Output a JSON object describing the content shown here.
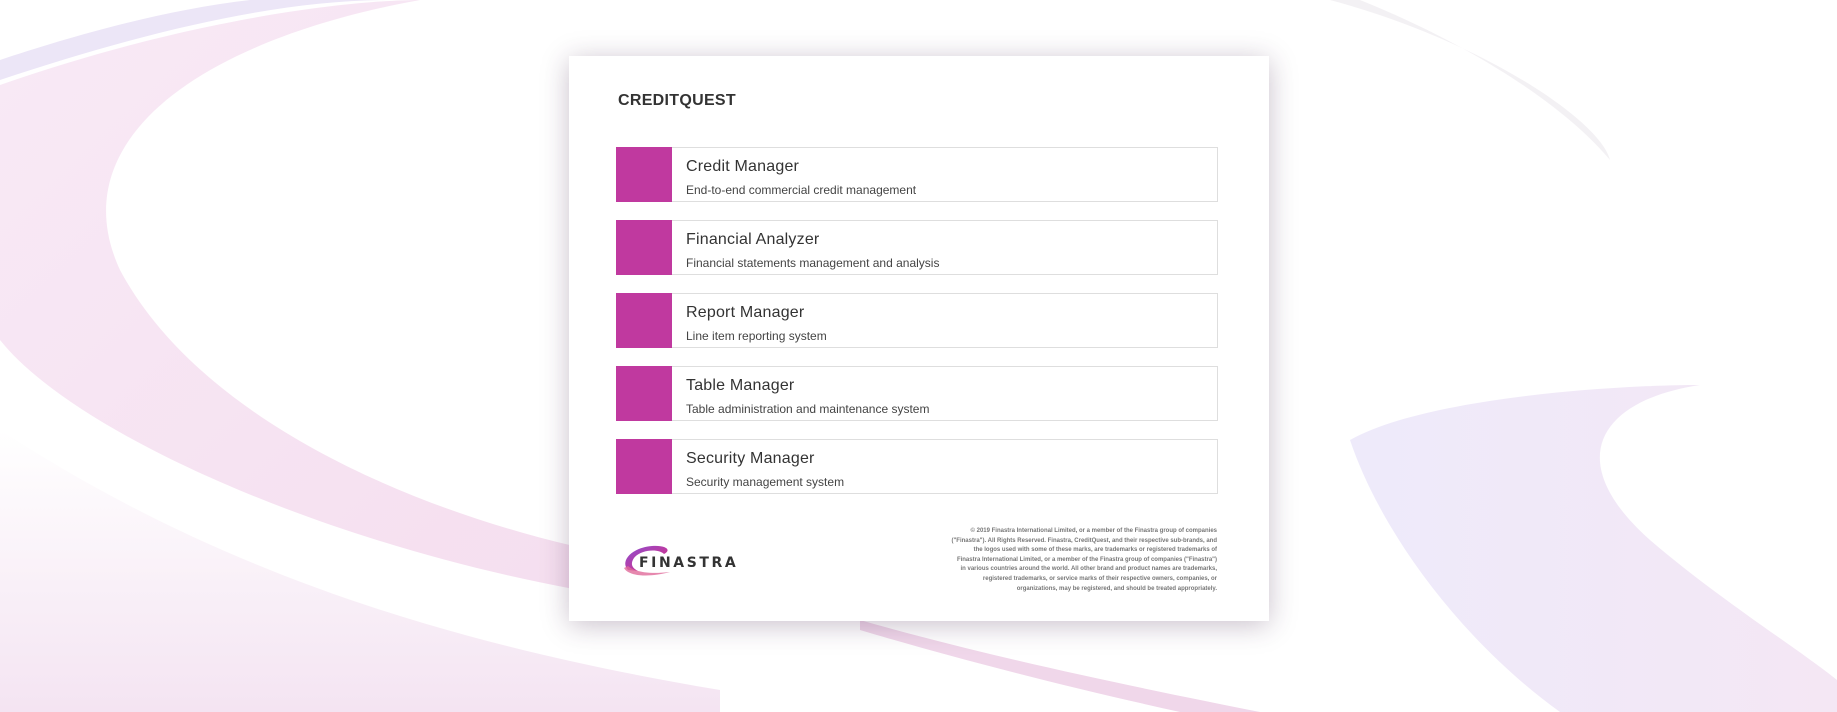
{
  "colors": {
    "accent": "#c0399f"
  },
  "header": {
    "title": "CREDITQUEST"
  },
  "apps": [
    {
      "name": "Credit Manager",
      "description": "End-to-end commercial credit management"
    },
    {
      "name": "Financial Analyzer",
      "description": "Financial statements management and analysis"
    },
    {
      "name": "Report Manager",
      "description": "Line item reporting system"
    },
    {
      "name": "Table Manager",
      "description": "Table administration and maintenance system"
    },
    {
      "name": "Security Manager",
      "description": "Security management system"
    }
  ],
  "footer": {
    "logo_text": "FINASTRA",
    "legal_lines": [
      "© 2019 Finastra International Limited, or a member of the Finastra group of companies",
      "(\"Finastra\"). All Rights Reserved. Finastra, CreditQuest, and their respective sub-brands, and",
      "the logos used with some of these marks, are trademarks or registered trademarks of",
      "Finastra International Limited, or a member of the Finastra group of companies (\"Finastra\")",
      "in various countries around the world. All other brand and product names are trademarks,",
      "registered trademarks, or service marks of their respective owners, companies, or",
      "organizations, may be registered, and should be treated appropriately."
    ]
  }
}
